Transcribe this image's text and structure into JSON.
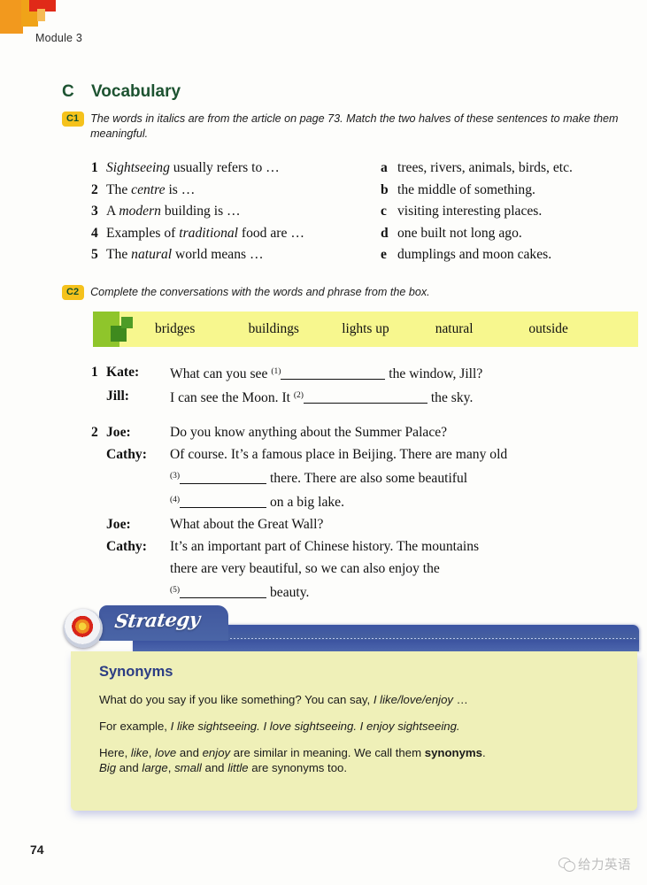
{
  "page": {
    "module_label": "Module 3",
    "page_number": "74",
    "background": "#fdfdfb"
  },
  "section": {
    "letter": "C",
    "title": "Vocabulary",
    "color": "#1d5331"
  },
  "exercises": [
    {
      "badge": "C1",
      "rubric": "The words in italics are from the article on page 73. Match the two halves of these sentences to make them meaningful.",
      "matching": {
        "left": [
          {
            "num": "1",
            "text_pre": "",
            "italic": "Sightseeing",
            "text_post": " usually refers to …"
          },
          {
            "num": "2",
            "text_pre": "The ",
            "italic": "centre",
            "text_post": " is …"
          },
          {
            "num": "3",
            "text_pre": "A ",
            "italic": "modern",
            "text_post": " building is …"
          },
          {
            "num": "4",
            "text_pre": "Examples of ",
            "italic": "traditional",
            "text_post": " food are …"
          },
          {
            "num": "5",
            "text_pre": "The ",
            "italic": "natural",
            "text_post": " world means …"
          }
        ],
        "right": [
          {
            "letter": "a",
            "text": "trees, rivers, animals, birds, etc."
          },
          {
            "letter": "b",
            "text": "the middle of something."
          },
          {
            "letter": "c",
            "text": "visiting interesting places."
          },
          {
            "letter": "d",
            "text": "one built not long ago."
          },
          {
            "letter": "e",
            "text": "dumplings and moon cakes."
          }
        ]
      }
    },
    {
      "badge": "C2",
      "rubric": "Complete the conversations with the words and phrase from the box.",
      "word_box": {
        "background": "#f7f78e",
        "accent": "#8fc52b",
        "words": [
          "bridges",
          "buildings",
          "lights up",
          "natural",
          "outside"
        ]
      },
      "conversations": [
        {
          "num": "1",
          "turns": [
            {
              "speaker": "Kate:",
              "parts": [
                {
                  "kind": "text",
                  "value": "What can you see "
                },
                {
                  "kind": "blank",
                  "sup": "(1)",
                  "width": 118
                },
                {
                  "kind": "text",
                  "value": " the window, Jill?"
                }
              ]
            },
            {
              "speaker": "Jill:",
              "parts": [
                {
                  "kind": "text",
                  "value": "I can see the Moon. It "
                },
                {
                  "kind": "blank",
                  "sup": "(2)",
                  "width": 140
                },
                {
                  "kind": "text",
                  "value": " the sky."
                }
              ]
            }
          ]
        },
        {
          "num": "2",
          "turns": [
            {
              "speaker": "Joe:",
              "parts": [
                {
                  "kind": "text",
                  "value": "Do you know anything about the Summer Palace?"
                }
              ]
            },
            {
              "speaker": "Cathy:",
              "parts": [
                {
                  "kind": "text",
                  "value": "Of course. It’s a famous place in Beijing. There are many old"
                },
                {
                  "kind": "break"
                },
                {
                  "kind": "blank",
                  "sup": "(3)",
                  "width": 98
                },
                {
                  "kind": "text",
                  "value": " there. There are also some beautiful"
                },
                {
                  "kind": "break"
                },
                {
                  "kind": "blank",
                  "sup": "(4)",
                  "width": 98
                },
                {
                  "kind": "text",
                  "value": " on a big lake."
                }
              ]
            },
            {
              "speaker": "Joe:",
              "parts": [
                {
                  "kind": "text",
                  "value": "What about the Great Wall?"
                }
              ]
            },
            {
              "speaker": "Cathy:",
              "parts": [
                {
                  "kind": "text",
                  "value": "It’s an important part of Chinese history. The mountains"
                },
                {
                  "kind": "break"
                },
                {
                  "kind": "text",
                  "value": "there are very beautiful, so we can also enjoy the"
                },
                {
                  "kind": "break"
                },
                {
                  "kind": "blank",
                  "sup": "(5)",
                  "width": 98
                },
                {
                  "kind": "text",
                  "value": " beauty."
                }
              ]
            }
          ]
        }
      ]
    }
  ],
  "strategy": {
    "tab_label": "Strategy",
    "icon": "target-icon",
    "bar_color": "#445da3",
    "body_color": "#eff0b8",
    "heading": "Synonyms",
    "heading_color": "#2c3d84",
    "paragraphs": [
      [
        {
          "kind": "text",
          "value": "What do you say if you like something? You can say, "
        },
        {
          "kind": "italic",
          "value": "I like/love/enjoy"
        },
        {
          "kind": "text",
          "value": " …"
        }
      ],
      [
        {
          "kind": "text",
          "value": "For example, "
        },
        {
          "kind": "italic",
          "value": "I like sightseeing. I love sightseeing. I enjoy sightseeing."
        }
      ],
      [
        {
          "kind": "text",
          "value": "Here, "
        },
        {
          "kind": "italic",
          "value": "like"
        },
        {
          "kind": "text",
          "value": ", "
        },
        {
          "kind": "italic",
          "value": "love"
        },
        {
          "kind": "text",
          "value": " and "
        },
        {
          "kind": "italic",
          "value": "enjoy"
        },
        {
          "kind": "text",
          "value": " are similar in meaning. We call them "
        },
        {
          "kind": "bold",
          "value": "synonyms"
        },
        {
          "kind": "text",
          "value": "."
        },
        {
          "kind": "break"
        },
        {
          "kind": "italic",
          "value": "Big"
        },
        {
          "kind": "text",
          "value": " and "
        },
        {
          "kind": "italic",
          "value": "large"
        },
        {
          "kind": "text",
          "value": ", "
        },
        {
          "kind": "italic",
          "value": "small"
        },
        {
          "kind": "text",
          "value": " and "
        },
        {
          "kind": "italic",
          "value": "little"
        },
        {
          "kind": "text",
          "value": " are synonyms too."
        }
      ]
    ]
  },
  "watermark": {
    "text": "给力英语",
    "icon": "wechat-icon",
    "color": "#bdbdbd"
  }
}
